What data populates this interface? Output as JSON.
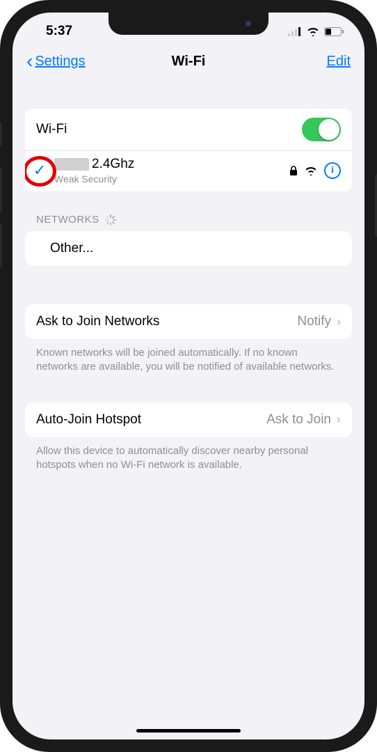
{
  "status": {
    "time": "5:37"
  },
  "nav": {
    "back": "Settings",
    "title": "Wi-Fi",
    "edit": "Edit"
  },
  "wifi": {
    "label": "Wi-Fi",
    "enabled": true
  },
  "connected": {
    "name_suffix": "2.4Ghz",
    "subtitle": "Weak Security"
  },
  "networks_header": "NETWORKS",
  "other": "Other...",
  "ask_join": {
    "label": "Ask to Join Networks",
    "value": "Notify",
    "footer": "Known networks will be joined automatically. If no known networks are available, you will be notified of available networks."
  },
  "auto_hotspot": {
    "label": "Auto-Join Hotspot",
    "value": "Ask to Join",
    "footer": "Allow this device to automatically discover nearby personal hotspots when no Wi-Fi network is available."
  }
}
